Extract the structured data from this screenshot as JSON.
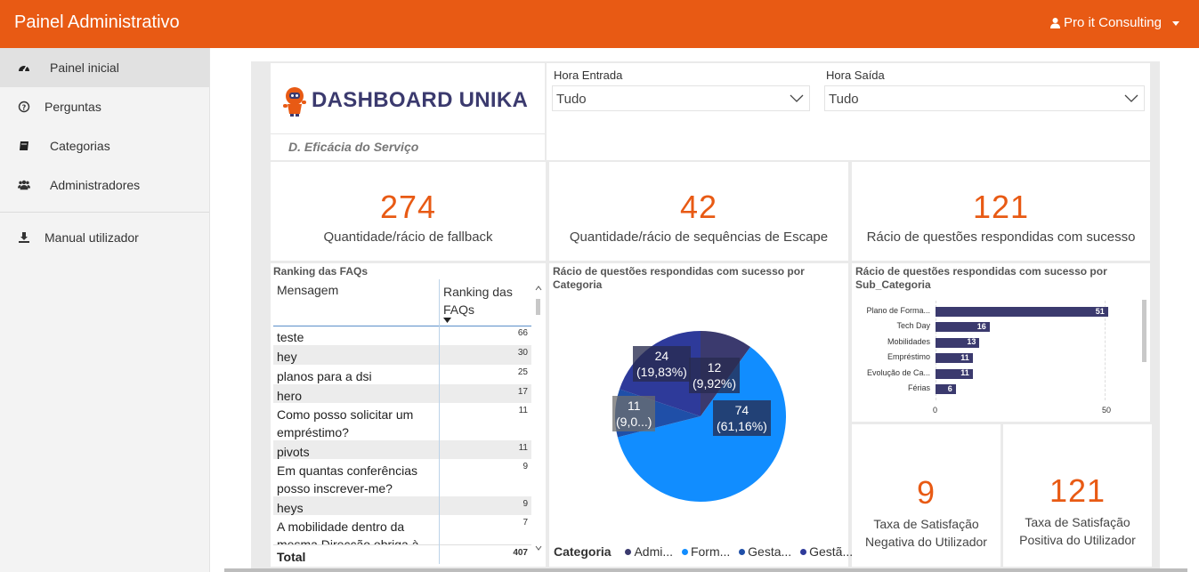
{
  "header": {
    "brand": "Painel Administrativo",
    "user": "Pro it Consulting"
  },
  "sidebar": {
    "items": [
      {
        "label": "Painel inicial",
        "icon": "dashboard-icon"
      },
      {
        "label": "Perguntas",
        "icon": "question-circle-icon"
      },
      {
        "label": "Categorias",
        "icon": "book-icon"
      },
      {
        "label": "Administradores",
        "icon": "users-icon"
      },
      {
        "label": "Manual utilizador",
        "icon": "download-icon"
      }
    ]
  },
  "dashboard": {
    "title": "DASHBOARD UNIKA",
    "subtitle": "D. Eficácia do Serviço",
    "filters": {
      "entrada": {
        "label": "Hora Entrada",
        "value": "Tudo"
      },
      "saida": {
        "label": "Hora Saída",
        "value": "Tudo"
      }
    },
    "kpis": [
      {
        "value": "274",
        "label": "Quantidade/rácio de fallback"
      },
      {
        "value": "42",
        "label": "Quantidade/rácio de sequências de Escape"
      },
      {
        "value": "121",
        "label": "Rácio de questões respondidas com sucesso"
      }
    ],
    "ranking": {
      "title": "Ranking das FAQs",
      "col_msg": "Mensagem",
      "col_rank": "Ranking das FAQs",
      "rows": [
        {
          "msg": "teste",
          "n": "66"
        },
        {
          "msg": "hey",
          "n": "30"
        },
        {
          "msg": "planos para a dsi",
          "n": "25"
        },
        {
          "msg": "hero",
          "n": "17"
        },
        {
          "msg": "Como posso solicitar um empréstimo?",
          "n": "11"
        },
        {
          "msg": "pivots",
          "n": "11"
        },
        {
          "msg": "Em quantas conferências posso inscrever-me?",
          "n": "9"
        },
        {
          "msg": "heys",
          "n": "9"
        },
        {
          "msg": "A mobilidade dentro da mesma Direcção obriga à",
          "n": "7"
        }
      ],
      "total_label": "Total",
      "total_value": "407"
    },
    "satisfaction": [
      {
        "value": "9",
        "label_1": "Taxa de Satisfação",
        "label_2": "Negativa do Utilizador"
      },
      {
        "value": "121",
        "label_1": "Taxa de Satisfação",
        "label_2": "Positiva do Utilizador"
      }
    ]
  },
  "chart_data": [
    {
      "type": "pie",
      "title": "Rácio de questões respondidas com sucesso por Categoria",
      "legend_title": "Categoria",
      "legend_placement": "bottom",
      "slices": [
        {
          "name": "Admi...",
          "value": 12,
          "label_1": "12",
          "label_2": "(9,92%)",
          "color": "#3b3a6e"
        },
        {
          "name": "Form...",
          "value": 74,
          "label_1": "74",
          "label_2": "(61,16%)",
          "color": "#118dff"
        },
        {
          "name": "Gesta...",
          "value": 11,
          "label_1": "11",
          "label_2": "(9,0...)",
          "color": "#1f4fa8"
        },
        {
          "name": "Gestã...",
          "value": 24,
          "label_1": "24",
          "label_2": "(19,83%)",
          "color": "#2e3a9a"
        }
      ]
    },
    {
      "type": "bar",
      "orientation": "horizontal",
      "title": "Rácio de questões respondidas com sucesso por Sub_Categoria",
      "categories": [
        "Plano de Forma...",
        "Tech Day",
        "Mobilidades",
        "Empréstimo",
        "Evolução de Ca...",
        "Férias"
      ],
      "values": [
        51,
        16,
        13,
        11,
        11,
        6
      ],
      "xlim": [
        0,
        50
      ],
      "xticks": [
        "0",
        "50"
      ],
      "grid": true
    }
  ]
}
